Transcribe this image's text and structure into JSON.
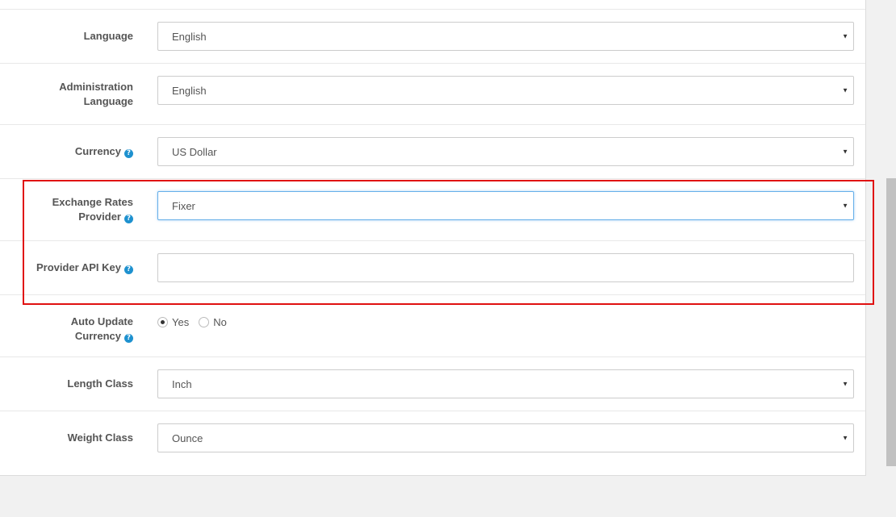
{
  "form": {
    "language": {
      "label": "Language",
      "value": "English"
    },
    "admin_language": {
      "label_line1": "Administration",
      "label_line2": "Language",
      "value": "English"
    },
    "currency": {
      "label": "Currency",
      "value": "US Dollar"
    },
    "exchange_provider": {
      "label_line1": "Exchange Rates",
      "label_line2": "Provider",
      "value": "Fixer"
    },
    "provider_api_key": {
      "label": "Provider API Key",
      "value": ""
    },
    "auto_update_currency": {
      "label_line1": "Auto Update",
      "label_line2": "Currency",
      "options": [
        "Yes",
        "No"
      ],
      "selected": "Yes"
    },
    "length_class": {
      "label": "Length Class",
      "value": "Inch"
    },
    "weight_class": {
      "label": "Weight Class",
      "value": "Ounce"
    }
  },
  "icons": {
    "help": "?",
    "caret": "▼"
  },
  "colors": {
    "help_icon": "#1e91cf",
    "highlight": "#e01010",
    "focus_border": "#66afe9"
  }
}
